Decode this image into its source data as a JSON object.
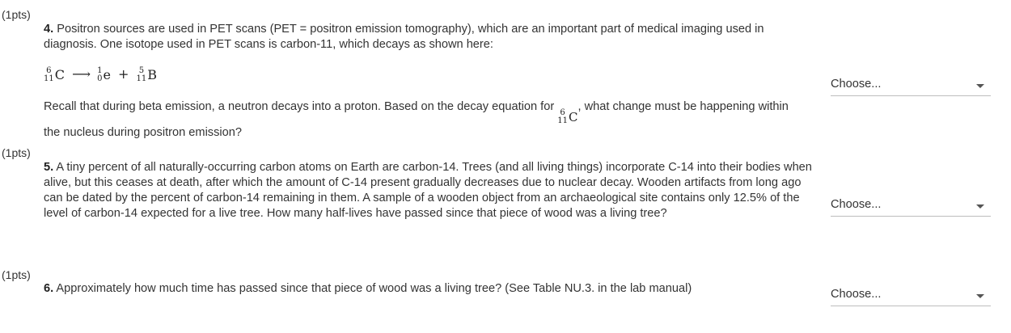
{
  "questions": [
    {
      "points": "(1pts)",
      "number": "4.",
      "text_part1": "Positron sources are used in PET scans (PET = positron emission tomography), which are an important part of medical imaging used in diagnosis. One isotope used in PET scans is carbon-11, which decays as shown here:",
      "equation": {
        "reactant": {
          "top": "6",
          "bottom": "11",
          "symbol": "C"
        },
        "arrow": "⟶",
        "product1": {
          "top": "1",
          "bottom": "0",
          "symbol": "e"
        },
        "plus": "+",
        "product2": {
          "top": "5",
          "bottom": "11",
          "symbol": "B"
        }
      },
      "text_part2_before": "Recall that during beta emission, a neutron decays into a proton. Based on the decay equation for",
      "inline_nuclide": {
        "top": "6",
        "bottom": "11",
        "symbol": "C"
      },
      "text_part2_after": ", what change must be happening within the nucleus during positron emission?",
      "select_value": "Choose..."
    },
    {
      "points": "(1pts)",
      "number": "5.",
      "text": "A tiny percent of all naturally-occurring carbon atoms on Earth are carbon-14. Trees (and all living things) incorporate C-14 into their bodies when alive, but this ceases at death, after which the amount of C-14 present gradually decreases due to nuclear decay. Wooden artifacts from long ago can be dated by the percent of carbon-14 remaining in them. A sample of a wooden object from an archaeological site contains only 12.5% of the level of carbon-14 expected for a live tree. How many half-lives have passed since that piece of wood was a living tree?",
      "select_value": "Choose..."
    },
    {
      "points": "(1pts)",
      "number": "6.",
      "text": "Approximately how much time has passed since that piece of wood was a living tree? (See Table NU.3. in the lab manual)",
      "select_value": "Choose..."
    }
  ]
}
